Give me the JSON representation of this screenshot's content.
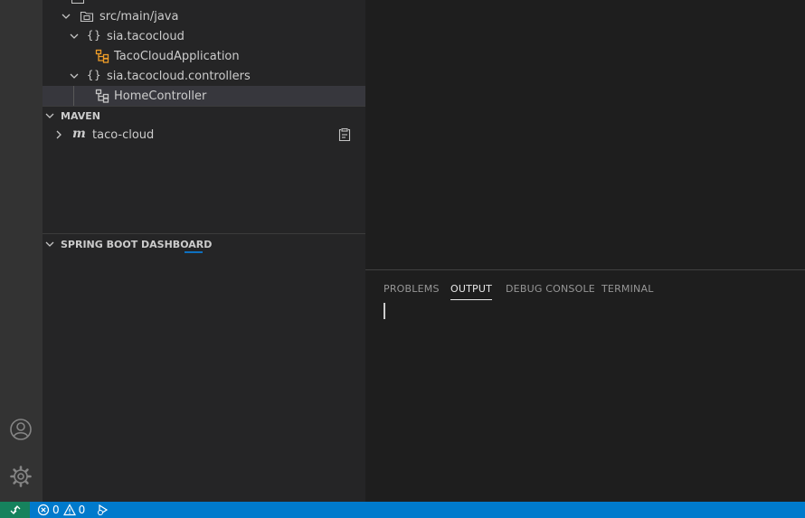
{
  "explorer": {
    "items": [
      {
        "label": "src/main/java",
        "icon": "source-folder-icon",
        "expanded": true
      },
      {
        "label": "sia.tacocloud",
        "icon": "package-icon",
        "expanded": true
      },
      {
        "label": "TacoCloudApplication",
        "icon": "class-icon"
      },
      {
        "label": "sia.tacocloud.controllers",
        "icon": "package-icon",
        "expanded": true
      },
      {
        "label": "HomeController",
        "icon": "class-icon",
        "selected": true
      }
    ]
  },
  "maven": {
    "header": "MAVEN",
    "items": [
      {
        "label": "taco-cloud",
        "icon": "maven-icon",
        "expanded": false
      }
    ]
  },
  "spring_boot": {
    "header": "SPRING BOOT DASHBOARD"
  },
  "panel": {
    "tabs": [
      {
        "label": "PROBLEMS",
        "active": false
      },
      {
        "label": "OUTPUT",
        "active": true
      },
      {
        "label": "DEBUG CONSOLE",
        "active": false
      },
      {
        "label": "TERMINAL",
        "active": false
      }
    ]
  },
  "status_bar": {
    "errors": "0",
    "warnings": "0"
  },
  "colors": {
    "status_bar": "#007acc",
    "remote": "#16825d",
    "class_icon": "#ee9d28",
    "sidebar": "#252526",
    "activity_bar": "#333333"
  }
}
